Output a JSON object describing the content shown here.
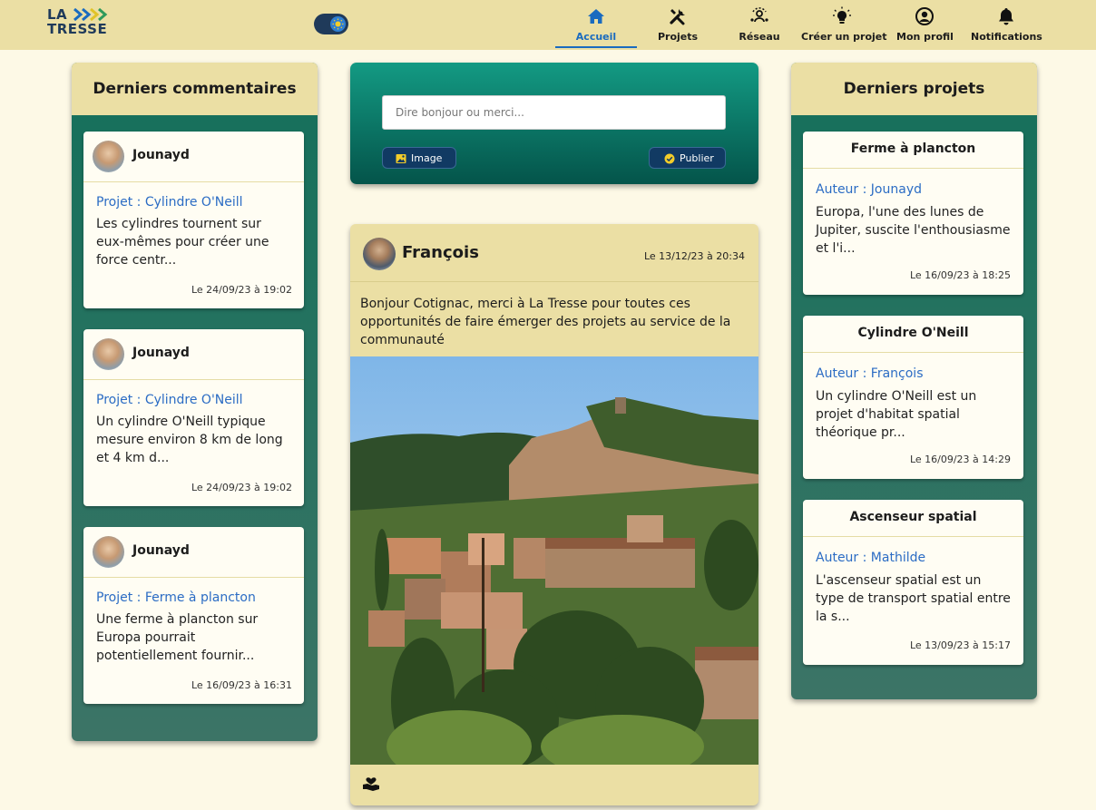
{
  "header": {
    "logo_line1": "LA",
    "logo_line2": "TRESSE",
    "nav": [
      {
        "label": "Accueil",
        "icon": "home-icon",
        "active": true
      },
      {
        "label": "Projets",
        "icon": "tools-icon",
        "active": false
      },
      {
        "label": "Réseau",
        "icon": "network-icon",
        "active": false
      },
      {
        "label": "Créer un projet",
        "icon": "lightbulb-icon",
        "active": false
      },
      {
        "label": "Mon profil",
        "icon": "user-circle-icon",
        "active": false
      },
      {
        "label": "Notifications",
        "icon": "bell-icon",
        "active": false
      }
    ]
  },
  "comments": {
    "title": "Derniers commentaires",
    "items": [
      {
        "author": "Jounayd",
        "project": "Projet : Cylindre O'Neill",
        "text": "Les cylindres tournent sur eux-mêmes pour créer une force centr...",
        "date": "Le 24/09/23 à 19:02"
      },
      {
        "author": "Jounayd",
        "project": "Projet : Cylindre O'Neill",
        "text": "Un cylindre O'Neill typique mesure environ 8 km de long et 4 km d...",
        "date": "Le 24/09/23 à 19:02"
      },
      {
        "author": "Jounayd",
        "project": "Projet : Ferme à plancton",
        "text": "Une ferme à plancton sur Europa pourrait potentiellement fournir...",
        "date": "Le 16/09/23 à 16:31"
      }
    ]
  },
  "composer": {
    "placeholder": "Dire bonjour ou merci...",
    "image_label": "Image",
    "publish_label": "Publier"
  },
  "post": {
    "author": "François",
    "date": "Le 13/12/23 à 20:34",
    "text": "Bonjour Cotignac, merci à La Tresse pour toutes ces opportunités de faire émerger des projets au service de la communauté"
  },
  "projects": {
    "title": "Derniers projets",
    "items": [
      {
        "title": "Ferme à plancton",
        "author": "Auteur : Jounayd",
        "text": "Europa, l'une des lunes de Jupiter, suscite l'enthousiasme et l'i...",
        "date": "Le 16/09/23 à 18:25"
      },
      {
        "title": "Cylindre O'Neill",
        "author": "Auteur : François",
        "text": "Un cylindre O'Neill est un projet d'habitat spatial théorique pr...",
        "date": "Le 16/09/23 à 14:29"
      },
      {
        "title": "Ascenseur spatial",
        "author": "Auteur : Mathilde",
        "text": "L'ascenseur spatial est un type de transport spatial entre la s...",
        "date": "Le 13/09/23 à 15:17"
      }
    ]
  },
  "colors": {
    "header_bg": "#ebdfa4",
    "page_bg": "#fdf9e6",
    "panel_green": "#14705b",
    "link_blue": "#2b6cc4",
    "button_navy": "#113a63"
  }
}
